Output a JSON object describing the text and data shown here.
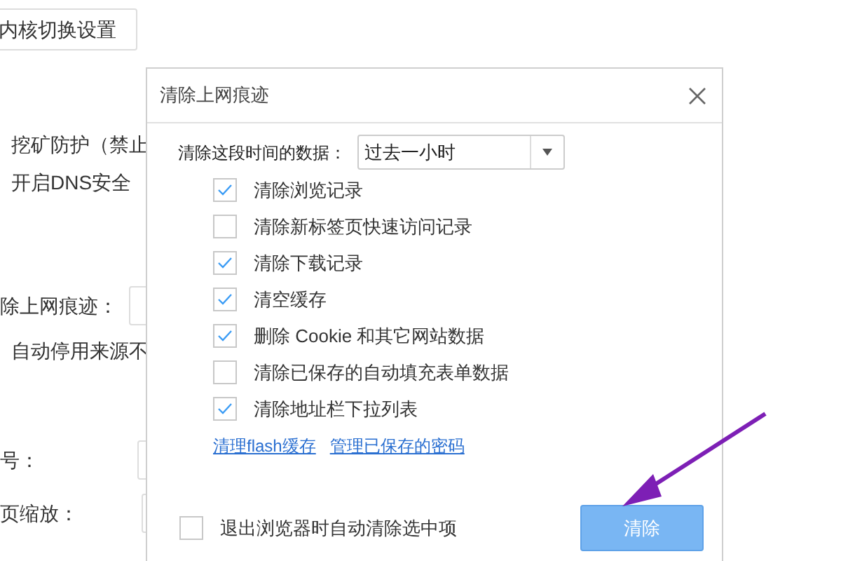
{
  "background": {
    "engine_button": "内核切换设置",
    "mining_protection": "挖矿防护（禁止",
    "dns": "开启DNS安全",
    "clear_traces_label": "除上网痕迹：",
    "auto_disable": "自动停用来源不",
    "font_label": "号：",
    "zoom_label": "页缩放："
  },
  "dialog": {
    "title": "清除上网痕迹",
    "range_label": "清除这段时间的数据：",
    "range_value": "过去一小时",
    "options": [
      {
        "label": "清除浏览记录",
        "checked": true
      },
      {
        "label": "清除新标签页快速访问记录",
        "checked": false
      },
      {
        "label": "清除下载记录",
        "checked": true
      },
      {
        "label": "清空缓存",
        "checked": true
      },
      {
        "label": "删除 Cookie 和其它网站数据",
        "checked": true
      },
      {
        "label": "清除已保存的自动填充表单数据",
        "checked": false
      },
      {
        "label": "清除地址栏下拉列表",
        "checked": true
      }
    ],
    "links": [
      "清理flash缓存",
      "管理已保存的密码"
    ],
    "auto_clear": {
      "label": "退出浏览器时自动清除选中项",
      "checked": false
    },
    "clear_button": "清除"
  }
}
